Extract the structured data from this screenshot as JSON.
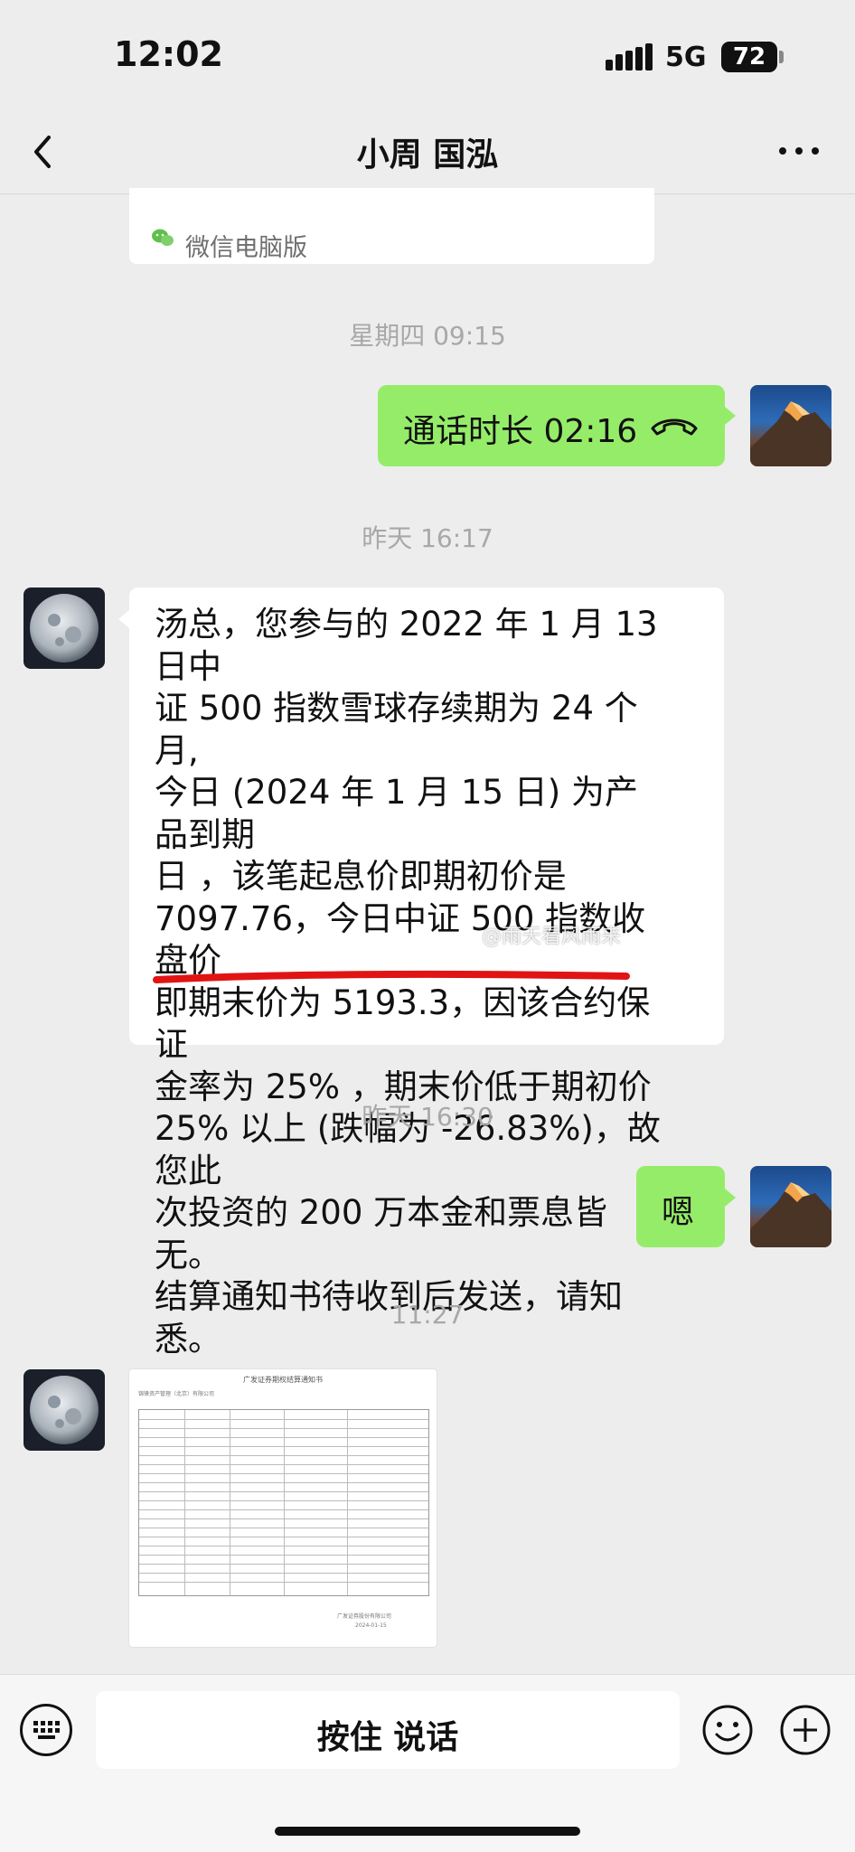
{
  "status_bar": {
    "time": "12:02",
    "network": "5G",
    "battery": "72"
  },
  "nav": {
    "title": "小周 国泓"
  },
  "messages": {
    "pc_source": "微信电脑版",
    "ts1": "星期四 09:15",
    "call": {
      "label": "通话时长 02:16"
    },
    "ts2": "昨天 16:17",
    "notice": {
      "line1": "汤总，您参与的 2022 年 1 月 13 日中",
      "line2": "证 500 指数雪球存续期为 24 个月,",
      "line3": "今日 (2024 年 1 月 15 日) 为产品到期",
      "line4": "日 ，该笔起息价即期初价是",
      "line5": "7097.76，今日中证 500 指数收盘价",
      "line6": "即期末价为 5193.3，因该合约保证",
      "line7": "金率为 25% ，期末价低于期初价",
      "line8": "25% 以上 (跌幅为 -26.83%)，故您此",
      "line9": "次投资的 200 万本金和票息皆无。",
      "line10": "结算通知书待收到后发送，请知悉。"
    },
    "watermark": "@雨天看风雨来",
    "ts3": "昨天 16:30",
    "reply": "嗯",
    "ts4": "11:27",
    "doc_title": "广发证券期权结算通知书",
    "doc_company": "锦锋资产管理（北京）有限公司",
    "doc_footer": "广发证券股份有限公司",
    "doc_date": "2024-01-15"
  },
  "input_bar": {
    "hold_to_talk": "按住 说话"
  }
}
